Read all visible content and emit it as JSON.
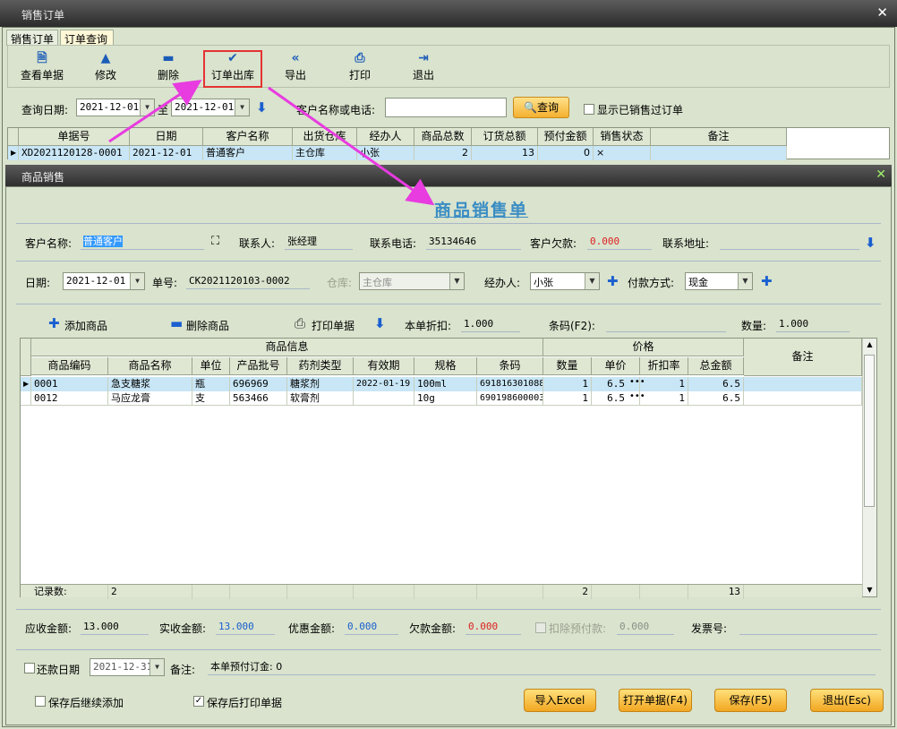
{
  "window": {
    "title": "销售订单"
  },
  "tabs": [
    {
      "label": "销售订单"
    },
    {
      "label": "订单查询"
    }
  ],
  "toolbar": {
    "view": "查看单据",
    "edit": "修改",
    "delete": "删除",
    "outbound": "订单出库",
    "export": "导出",
    "print": "打印",
    "exit": "退出"
  },
  "query": {
    "date_label": "查询日期:",
    "date_from": "2021-12-01",
    "to_label": "至",
    "date_to": "2021-12-01",
    "customer_label": "客户名称或电话:",
    "search_btn": "查询",
    "show_sold": "显示已销售过订单"
  },
  "order_table": {
    "headers": [
      "单据号",
      "日期",
      "客户名称",
      "出货仓库",
      "经办人",
      "商品总数",
      "订货总额",
      "预付金额",
      "销售状态",
      "备注"
    ],
    "row": [
      "XD2021120128-0001",
      "2021-12-01",
      "普通客户",
      "主仓库",
      "小张",
      "2",
      "13",
      "0",
      "×",
      ""
    ]
  },
  "dialog": {
    "title": "商品销售",
    "heading": "商品销售单",
    "customer_label": "客户名称:",
    "customer": "普通客户",
    "contact_label": "联系人:",
    "contact": "张经理",
    "phone_label": "联系电话:",
    "phone": "35134646",
    "debt_label": "客户欠款:",
    "debt": "0.000",
    "address_label": "联系地址:",
    "date_label": "日期:",
    "date": "2021-12-01",
    "no_label": "单号:",
    "no": "CK2021120103-0002",
    "warehouse_label": "仓库:",
    "warehouse": "主仓库",
    "handler_label": "经办人:",
    "handler": "小张",
    "payment_label": "付款方式:",
    "payment": "现金",
    "add_goods": "添加商品",
    "del_goods": "删除商品",
    "print_doc": "打印单据",
    "discount_label": "本单折扣:",
    "discount": "1.000",
    "barcode_label": "条码(F2):",
    "qty_label": "数量:",
    "qty": "1.000"
  },
  "goods_table": {
    "group_info": "商品信息",
    "group_price": "价格",
    "remark": "备注",
    "headers": [
      "商品编码",
      "商品名称",
      "单位",
      "产品批号",
      "药剂类型",
      "有效期",
      "规格",
      "条码",
      "数量",
      "单价",
      "折扣率",
      "总金额"
    ],
    "rows": [
      [
        "0001",
        "急支糖浆",
        "瓶",
        "696969",
        "糖浆剂",
        "2022-01-19",
        "100ml",
        "691816301088",
        "1",
        "6.5",
        "1",
        "6.5"
      ],
      [
        "0012",
        "马应龙膏",
        "支",
        "563466",
        "软膏剂",
        "",
        "10g",
        "690198600003",
        "1",
        "6.5",
        "1",
        "6.5"
      ]
    ],
    "footer_label": "记录数:",
    "footer_count": "2",
    "footer_qty": "2",
    "footer_total": "13"
  },
  "totals": {
    "receivable_label": "应收金额:",
    "receivable": "13.000",
    "received_label": "实收金额:",
    "received": "13.000",
    "discount_label": "优惠金额:",
    "discount": "0.000",
    "owed_label": "欠款金额:",
    "owed": "0.000",
    "deduct_label": "扣除预付款:",
    "deduct": "0.000",
    "invoice_label": "发票号:"
  },
  "repay": {
    "label": "还款日期",
    "date": "2021-12-31",
    "note_label": "备注:",
    "note": "本单预付订金: 0"
  },
  "options": {
    "continue_add": "保存后继续添加",
    "print_after_save": "保存后打印单据"
  },
  "buttons": {
    "import_excel": "导入Excel",
    "open_doc": "打开单据(F4)",
    "save": "保存(F5)",
    "exit": "退出(Esc)"
  }
}
